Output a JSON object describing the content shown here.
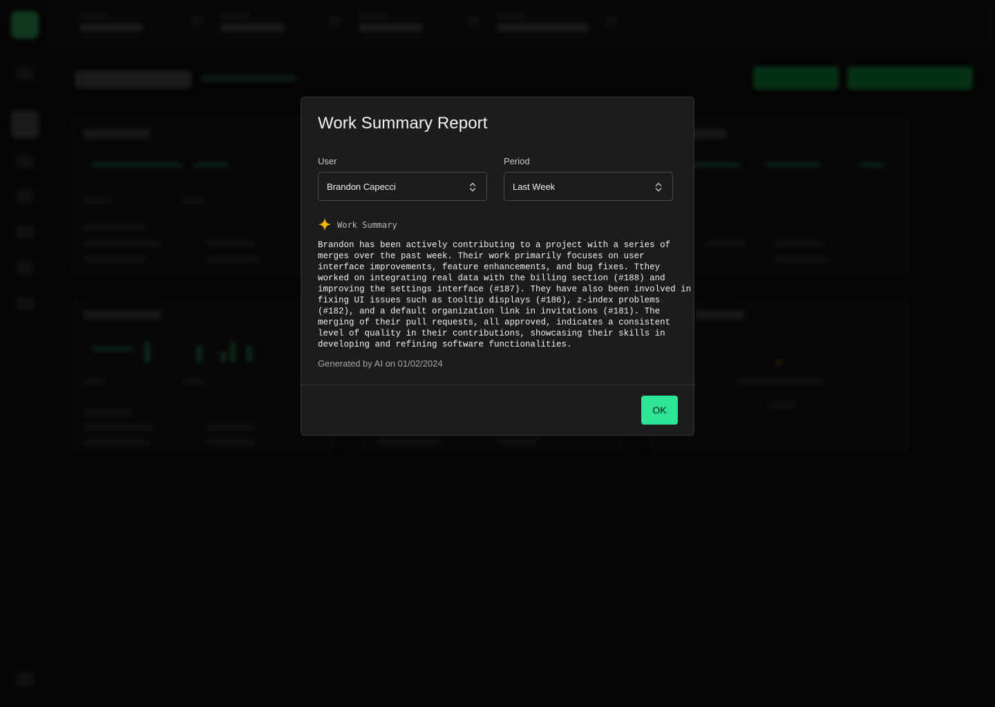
{
  "modal": {
    "title": "Work Summary Report",
    "user_label": "User",
    "user_value": "Brandon Capecci",
    "period_label": "Period",
    "period_value": "Last Week",
    "summary_label": "Work Summary",
    "summary_lines": [
      "Brandon has been actively contributing to a project with a series of",
      "merges over the past week. Their work primarily focuses on user",
      "interface improvements, feature enhancements, and bug fixes. Tthey",
      "worked on integrating real data with the billing section (#188) and",
      "improving the settings interface (#187). They have also been involved in",
      "fixing UI issues such as tooltip displays (#186), z-index problems",
      "(#182), and a default organization link in invitations (#181). The",
      "merging of their pull requests, all approved, indicates a consistent",
      "level of quality in their contributions, showcasing their skills in",
      "developing and refining software functionalities."
    ],
    "generated": "Generated by AI on 01/02/2024",
    "ok_label": "OK"
  },
  "colors": {
    "accent": "#2ee596",
    "spark": "#f5b800",
    "modal_bg": "#1c1c1c"
  },
  "icons": {
    "summary": "sparkle-icon",
    "select": "chevron-up-down-icon"
  }
}
